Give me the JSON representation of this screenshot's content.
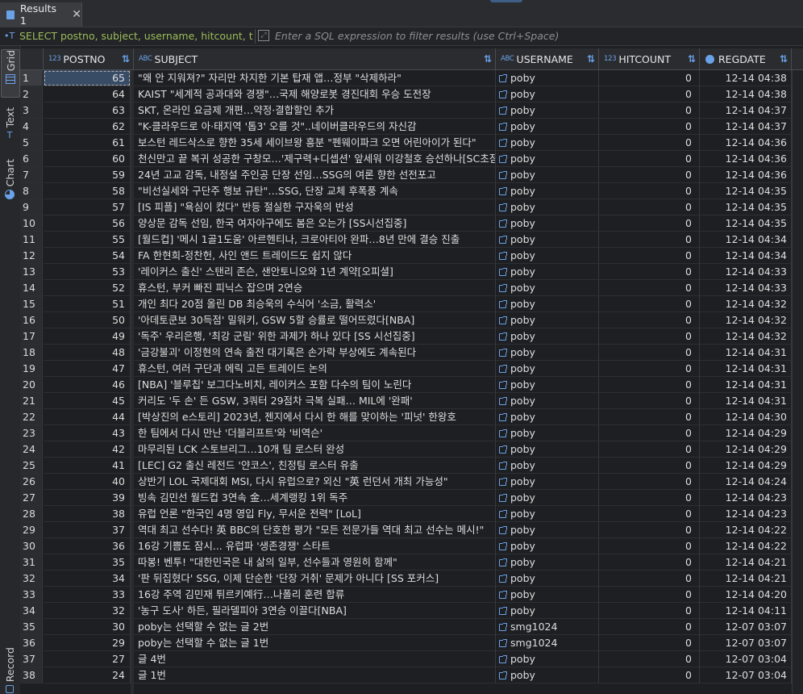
{
  "tab": {
    "label": "Results 1",
    "close": "✕"
  },
  "filter": {
    "sql": "SELECT postno, subject, username, hitcount, tc",
    "placeholder": "Enter a SQL expression to filter results (use Ctrl+Space)"
  },
  "sidebar": {
    "grid": "Grid",
    "text": "Text",
    "chart": "Chart",
    "record": "Record"
  },
  "columns": [
    {
      "type": "123",
      "name": "POSTNO"
    },
    {
      "type": "ABC",
      "name": "SUBJECT"
    },
    {
      "type": "ABC",
      "name": "USERNAME"
    },
    {
      "type": "123",
      "name": "HITCOUNT"
    },
    {
      "type": "clock",
      "name": "REGDATE"
    }
  ],
  "rows": [
    {
      "n": "1",
      "postno": "65",
      "subject": "\"왜 안 지워져?\" 자리만 차지한 기본 탑재 앱…정부 \"삭제하라\"",
      "username": "poby",
      "hitcount": "0",
      "regdate": "12-14 04:38"
    },
    {
      "n": "2",
      "postno": "64",
      "subject": "KAIST \"세계적 공과대와 경쟁\"…국제 해양로봇 경진대회 우승 도전장",
      "username": "poby",
      "hitcount": "0",
      "regdate": "12-14 04:38"
    },
    {
      "n": "3",
      "postno": "63",
      "subject": "SKT, 온라인 요금제 개편…약정·결합할인 추가",
      "username": "poby",
      "hitcount": "0",
      "regdate": "12-14 04:37"
    },
    {
      "n": "4",
      "postno": "62",
      "subject": "\"K-클라우드로 아·태지역 '톱3' 오를 것\"..네이버클라우드의 자신감",
      "username": "poby",
      "hitcount": "0",
      "regdate": "12-14 04:37"
    },
    {
      "n": "5",
      "postno": "61",
      "subject": "보스턴 레드삭스로 향한 35세 세이브왕 흥분 \"펜웨이파크 오면 어린아이가 된다\"",
      "username": "poby",
      "hitcount": "0",
      "regdate": "12-14 04:36"
    },
    {
      "n": "6",
      "postno": "60",
      "subject": "천신만고 끝 복귀 성공한 구창모…'제구력+디셉션' 앞세워 이강철호 승선하나[SC초점]",
      "username": "poby",
      "hitcount": "0",
      "regdate": "12-14 04:36"
    },
    {
      "n": "7",
      "postno": "59",
      "subject": "24년 고교 감독, 내정설 주인공 단장 선임…SSG의 여론 향한 선전포고",
      "username": "poby",
      "hitcount": "0",
      "regdate": "12-14 04:36"
    },
    {
      "n": "8",
      "postno": "58",
      "subject": "\"비선실세와 구단주 행보 규탄\"…SSG, 단장 교체 후폭풍 계속",
      "username": "poby",
      "hitcount": "0",
      "regdate": "12-14 04:35"
    },
    {
      "n": "9",
      "postno": "57",
      "subject": "[IS 피플] \"욕심이 컸다\" 반등 절실한 구자욱의 반성",
      "username": "poby",
      "hitcount": "0",
      "regdate": "12-14 04:35"
    },
    {
      "n": "10",
      "postno": "56",
      "subject": "양상문 감독 선임, 한국 여자야구에도 봄은 오는가 [SS시선집중]",
      "username": "poby",
      "hitcount": "0",
      "regdate": "12-14 04:35"
    },
    {
      "n": "11",
      "postno": "55",
      "subject": "[월드컵] '메시 1골1도움' 아르헨티나, 크로아티아 완파…8년 만에 결승 진출",
      "username": "poby",
      "hitcount": "0",
      "regdate": "12-14 04:34"
    },
    {
      "n": "12",
      "postno": "54",
      "subject": "FA 한현희-정찬헌, 사인 앤드 트레이드도 쉽지 않다",
      "username": "poby",
      "hitcount": "0",
      "regdate": "12-14 04:34"
    },
    {
      "n": "13",
      "postno": "53",
      "subject": "'레이커스 출신' 스탠리 존슨, 샌안토니오와 1년 계약[오피셜]",
      "username": "poby",
      "hitcount": "0",
      "regdate": "12-14 04:33"
    },
    {
      "n": "14",
      "postno": "52",
      "subject": "휴스턴, 부커 빠진 피닉스 잡으며 2연승",
      "username": "poby",
      "hitcount": "0",
      "regdate": "12-14 04:33"
    },
    {
      "n": "15",
      "postno": "51",
      "subject": "개인 최다 20점 올린 DB 최승욱의 수식어 '소금, 활력소'",
      "username": "poby",
      "hitcount": "0",
      "regdate": "12-14 04:32"
    },
    {
      "n": "16",
      "postno": "50",
      "subject": "'아데토쿤보 30득점' 밀워키, GSW 5할 승률로 떨어뜨렸다[NBA]",
      "username": "poby",
      "hitcount": "0",
      "regdate": "12-14 04:32"
    },
    {
      "n": "17",
      "postno": "49",
      "subject": "'독주' 우리은행, '최강 군림' 위한 과제가 하나 있다 [SS 시선집중]",
      "username": "poby",
      "hitcount": "0",
      "regdate": "12-14 04:32"
    },
    {
      "n": "18",
      "postno": "48",
      "subject": "'금강불괴' 이정현의 연속 출전 대기록은 손가락 부상에도 계속된다",
      "username": "poby",
      "hitcount": "0",
      "regdate": "12-14 04:31"
    },
    {
      "n": "19",
      "postno": "47",
      "subject": "휴스턴, 여러 구단과 에릭 고든 트레이드 논의",
      "username": "poby",
      "hitcount": "0",
      "regdate": "12-14 04:31"
    },
    {
      "n": "20",
      "postno": "46",
      "subject": "[NBA] '블루칩' 보그다노비치, 레이커스 포함 다수의 팀이 노린다",
      "username": "poby",
      "hitcount": "0",
      "regdate": "12-14 04:31"
    },
    {
      "n": "21",
      "postno": "45",
      "subject": "커리도 '두 손' 든 GSW, 3쿼터 29점차 극복 실패… MIL에 '완패'",
      "username": "poby",
      "hitcount": "0",
      "regdate": "12-14 04:31"
    },
    {
      "n": "22",
      "postno": "44",
      "subject": "[박상진의 e스토리] 2023년, 젠지에서 다시 한 해를 맞이하는 '피넛' 한왕호",
      "username": "poby",
      "hitcount": "0",
      "regdate": "12-14 04:30"
    },
    {
      "n": "23",
      "postno": "43",
      "subject": "한 팀에서 다시 만난 '더블리프트'와 '비역슨'",
      "username": "poby",
      "hitcount": "0",
      "regdate": "12-14 04:29"
    },
    {
      "n": "24",
      "postno": "42",
      "subject": "마무리된 LCK 스토브리그…10개 팀 로스터 완성",
      "username": "poby",
      "hitcount": "0",
      "regdate": "12-14 04:29"
    },
    {
      "n": "25",
      "postno": "41",
      "subject": "[LEC] G2 출신 레전드 '얀코스', 친정팀 로스터 유출",
      "username": "poby",
      "hitcount": "0",
      "regdate": "12-14 04:29"
    },
    {
      "n": "26",
      "postno": "40",
      "subject": "상반기 LOL 국제대회 MSI, 다시 유럽으로? 외신 \"英 런던서 개최 가능성\"",
      "username": "poby",
      "hitcount": "0",
      "regdate": "12-14 04:24"
    },
    {
      "n": "27",
      "postno": "39",
      "subject": "빙속 김민선 월드컵 3연속 金…세계랭킹 1위 독주",
      "username": "poby",
      "hitcount": "0",
      "regdate": "12-14 04:23"
    },
    {
      "n": "28",
      "postno": "38",
      "subject": "유럽 언론 \"한국인 4명 영입 Fly, 무서운 전력\" [LoL]",
      "username": "poby",
      "hitcount": "0",
      "regdate": "12-14 04:23"
    },
    {
      "n": "29",
      "postno": "37",
      "subject": "역대 최고 선수다! 英 BBC의 단호한 평가 \"모든 전문가들 역대 최고 선수는 메시!\"",
      "username": "poby",
      "hitcount": "0",
      "regdate": "12-14 04:22"
    },
    {
      "n": "30",
      "postno": "36",
      "subject": "16강 기쁨도 잠시... 유럽파 '생존경쟁' 스타트",
      "username": "poby",
      "hitcount": "0",
      "regdate": "12-14 04:22"
    },
    {
      "n": "31",
      "postno": "35",
      "subject": "따봉! 벤투! \"대한민국은 내 삶의 일부, 선수들과 영원히 함께\"",
      "username": "poby",
      "hitcount": "0",
      "regdate": "12-14 04:21"
    },
    {
      "n": "32",
      "postno": "34",
      "subject": "'판 뒤집혔다' SSG, 이제 단순한 '단장 거취' 문제가 아니다 [SS 포커스]",
      "username": "poby",
      "hitcount": "0",
      "regdate": "12-14 04:21"
    },
    {
      "n": "33",
      "postno": "33",
      "subject": "16강 주역 김민재 튀르키예行…나폴리 훈련 합류",
      "username": "poby",
      "hitcount": "0",
      "regdate": "12-14 04:20"
    },
    {
      "n": "34",
      "postno": "32",
      "subject": "'농구 도사' 하든, 필라델피아 3연승 이끌다[NBA]",
      "username": "poby",
      "hitcount": "0",
      "regdate": "12-14 04:11"
    },
    {
      "n": "35",
      "postno": "30",
      "subject": "poby는 선택할 수 없는 글 2번",
      "username": "smg1024",
      "hitcount": "0",
      "regdate": "12-07 03:07"
    },
    {
      "n": "36",
      "postno": "29",
      "subject": "poby는 선택할 수 없는 글 1번",
      "username": "smg1024",
      "hitcount": "0",
      "regdate": "12-07 03:07"
    },
    {
      "n": "37",
      "postno": "27",
      "subject": "글 4번",
      "username": "poby",
      "hitcount": "0",
      "regdate": "12-07 03:04"
    },
    {
      "n": "38",
      "postno": "24",
      "subject": "글 1번",
      "username": "poby",
      "hitcount": "0",
      "regdate": "12-07 03:04"
    }
  ]
}
